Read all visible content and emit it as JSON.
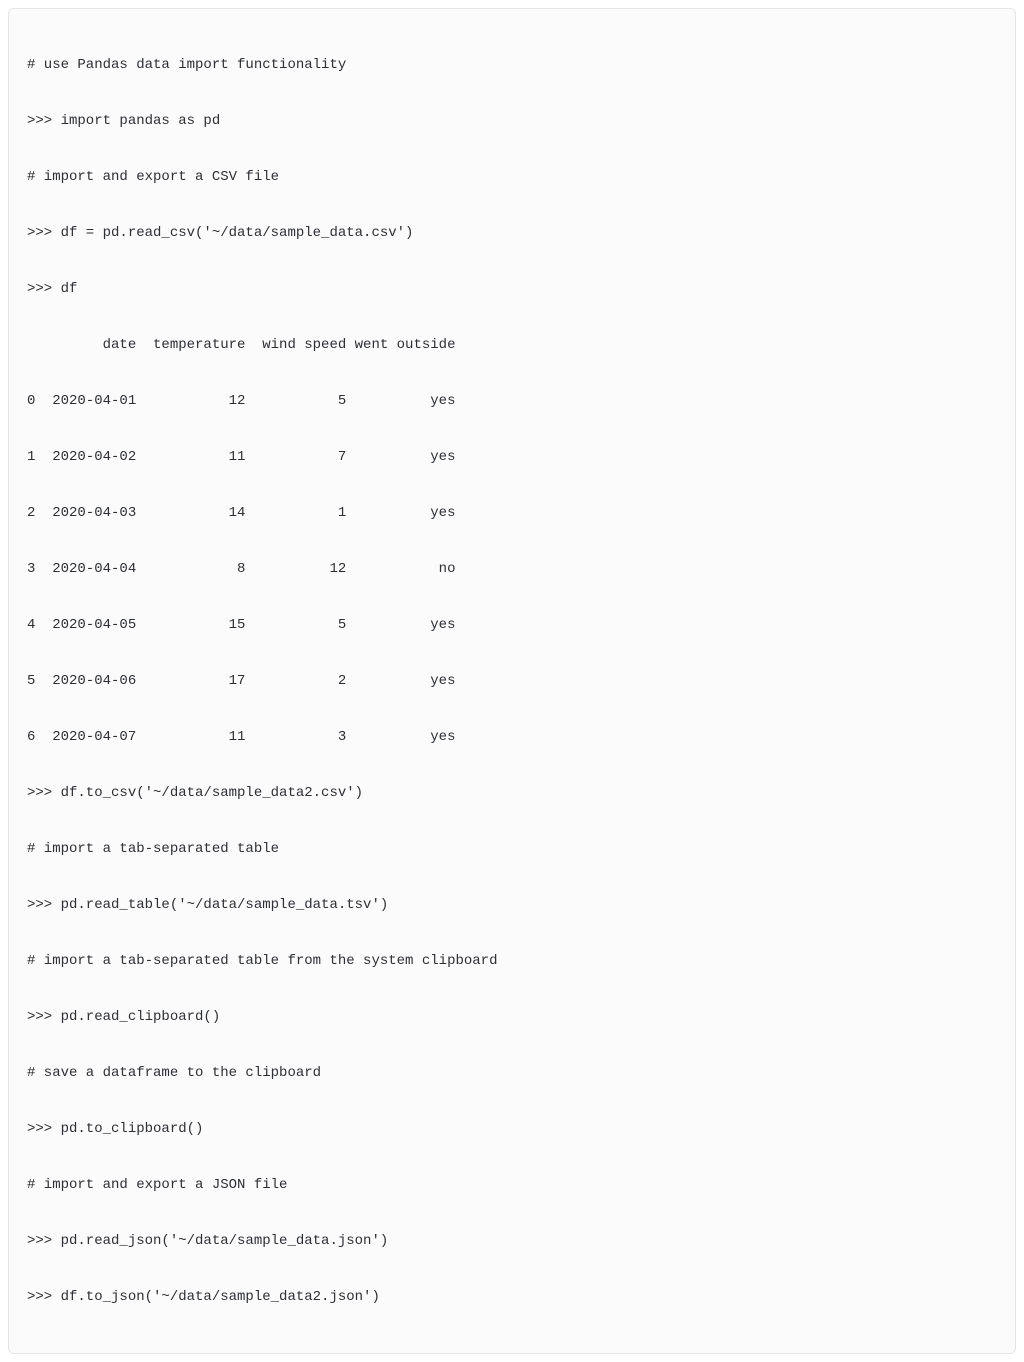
{
  "code": {
    "lines": [
      "# use Pandas data import functionality",
      ">>> import pandas as pd",
      "# import and export a CSV file",
      ">>> df = pd.read_csv('~/data/sample_data.csv')",
      ">>> df",
      "         date  temperature  wind speed went outside",
      "0  2020-04-01           12           5          yes",
      "1  2020-04-02           11           7          yes",
      "2  2020-04-03           14           1          yes",
      "3  2020-04-04            8          12           no",
      "4  2020-04-05           15           5          yes",
      "5  2020-04-06           17           2          yes",
      "6  2020-04-07           11           3          yes",
      ">>> df.to_csv('~/data/sample_data2.csv')",
      "# import a tab-separated table",
      ">>> pd.read_table('~/data/sample_data.tsv')",
      "# import a tab-separated table from the system clipboard",
      ">>> pd.read_clipboard()",
      "# save a dataframe to the clipboard",
      ">>> pd.to_clipboard()",
      "# import and export a JSON file",
      ">>> pd.read_json('~/data/sample_data.json')",
      ">>> df.to_json('~/data/sample_data2.json')"
    ]
  },
  "dataframe": {
    "columns": [
      "date",
      "temperature",
      "wind speed",
      "went outside"
    ],
    "rows": [
      {
        "index": 0,
        "date": "2020-04-01",
        "temperature": 12,
        "wind_speed": 5,
        "went_outside": "yes"
      },
      {
        "index": 1,
        "date": "2020-04-02",
        "temperature": 11,
        "wind_speed": 7,
        "went_outside": "yes"
      },
      {
        "index": 2,
        "date": "2020-04-03",
        "temperature": 14,
        "wind_speed": 1,
        "went_outside": "yes"
      },
      {
        "index": 3,
        "date": "2020-04-04",
        "temperature": 8,
        "wind_speed": 12,
        "went_outside": "no"
      },
      {
        "index": 4,
        "date": "2020-04-05",
        "temperature": 15,
        "wind_speed": 5,
        "went_outside": "yes"
      },
      {
        "index": 5,
        "date": "2020-04-06",
        "temperature": 17,
        "wind_speed": 2,
        "went_outside": "yes"
      },
      {
        "index": 6,
        "date": "2020-04-07",
        "temperature": 11,
        "wind_speed": 3,
        "went_outside": "yes"
      }
    ]
  }
}
